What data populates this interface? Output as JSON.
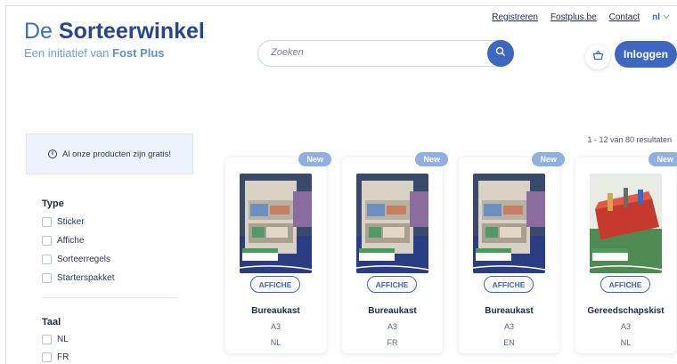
{
  "brand": {
    "prefix": "De",
    "name": "Sorteerwinkel",
    "tagline_prefix": "Een initiatief van",
    "tagline_brand": "Fost Plus"
  },
  "nav": {
    "links": [
      "Registreren",
      "Fostplus.be",
      "Contact"
    ],
    "language": "nl"
  },
  "search": {
    "placeholder": "Zoeken"
  },
  "login_label": "Inloggen",
  "notice": "Al onze producten zijn gratis!",
  "filters": {
    "type": {
      "title": "Type",
      "options": [
        "Sticker",
        "Affiche",
        "Sorteerregels",
        "Starterspakket"
      ]
    },
    "language": {
      "title": "Taal",
      "options": [
        "NL",
        "FR"
      ]
    }
  },
  "results_text": "1 - 12 van 80 resultaten",
  "products": [
    {
      "badge": "New",
      "tag": "AFFICHE",
      "name": "Bureaukast",
      "format": "A3",
      "language": "NL",
      "poster_text": "PMD sorteren. Maak er een fijn werk van."
    },
    {
      "badge": "New",
      "tag": "AFFICHE",
      "name": "Bureaukast",
      "format": "A3",
      "language": "FR",
      "poster_text": "Trier les PMD. Tout de travail."
    },
    {
      "badge": "New",
      "tag": "AFFICHE",
      "name": "Bureaukast",
      "format": "A3",
      "language": "EN",
      "poster_text": "Sorting PMD. Make something to work on."
    },
    {
      "badge": "New",
      "tag": "AFFICHE",
      "name": "Gereedschapskist",
      "format": "A3",
      "language": "NL",
      "poster_text": "PMD sorteren. Maak er een fijn werk van."
    }
  ],
  "colors": {
    "primary": "#3e67c2",
    "brand_dark": "#26478f",
    "brand_light": "#6fa0e0",
    "badge": "#8fb0e0"
  }
}
